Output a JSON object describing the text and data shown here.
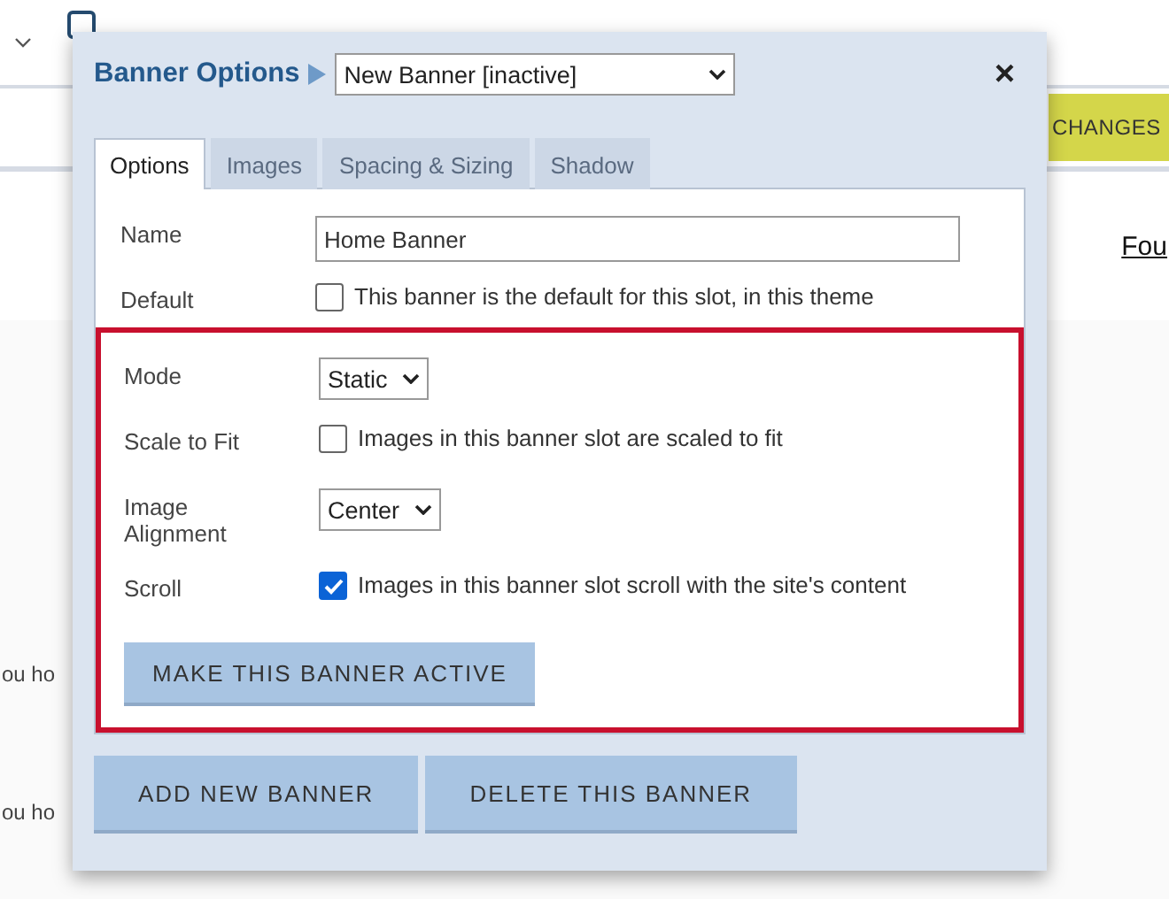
{
  "background": {
    "save_button": "CHANGES",
    "link": "Fou",
    "snippets": [
      "ou ho",
      "ou ho"
    ]
  },
  "dialog": {
    "title": "Banner Options",
    "banner_select": "New Banner [inactive]",
    "close": "×",
    "tabs": [
      {
        "label": "Options",
        "selected": true
      },
      {
        "label": "Images",
        "selected": false
      },
      {
        "label": "Spacing & Sizing",
        "selected": false
      },
      {
        "label": "Shadow",
        "selected": false
      }
    ],
    "fields": [
      {
        "kind": "text",
        "label": "Name",
        "value": "Home Banner",
        "highlighted": false
      },
      {
        "kind": "checkbox",
        "label": "Default",
        "text": "This banner is the default for this slot, in this theme",
        "checked": false,
        "highlighted": false
      },
      {
        "kind": "select",
        "label": "Mode",
        "value": "Static",
        "highlighted": true
      },
      {
        "kind": "checkbox",
        "label": "Scale to Fit",
        "text": "Images in this banner slot are scaled to fit",
        "checked": false,
        "highlighted": true
      },
      {
        "kind": "select",
        "label": "Image Alignment",
        "value": "Center",
        "highlighted": true
      },
      {
        "kind": "checkbox",
        "label": "Scroll",
        "text": "Images in this banner slot scroll with the site's content",
        "checked": true,
        "highlighted": true
      }
    ],
    "panel_button": "MAKE THIS BANNER ACTIVE",
    "buttons": [
      "ADD NEW BANNER",
      "DELETE THIS BANNER"
    ]
  }
}
